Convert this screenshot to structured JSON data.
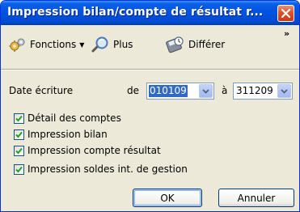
{
  "window": {
    "title": "Impression bilan/compte de résultat r..."
  },
  "toolbar": {
    "items": [
      {
        "label": "Fonctions",
        "icon": "gears-icon",
        "has_dropdown": true
      },
      {
        "label": "Plus",
        "icon": "magnifier-icon"
      },
      {
        "label": "Différer",
        "icon": "disk-clock-icon"
      }
    ],
    "overflow": "»"
  },
  "form": {
    "date_label": "Date écriture",
    "from_label": "de",
    "from_value": "010109",
    "to_label": "à",
    "to_value": "311209"
  },
  "checkboxes": [
    {
      "label": "Détail des comptes",
      "checked": true
    },
    {
      "label": "Impression bilan",
      "checked": true
    },
    {
      "label": "Impression compte résultat",
      "checked": true
    },
    {
      "label": "Impression soldes int. de gestion",
      "checked": true
    }
  ],
  "buttons": {
    "ok": "OK",
    "cancel": "Annuler"
  },
  "colors": {
    "titlebar": "#0053e0",
    "close": "#e0502a",
    "check": "#21a121"
  }
}
